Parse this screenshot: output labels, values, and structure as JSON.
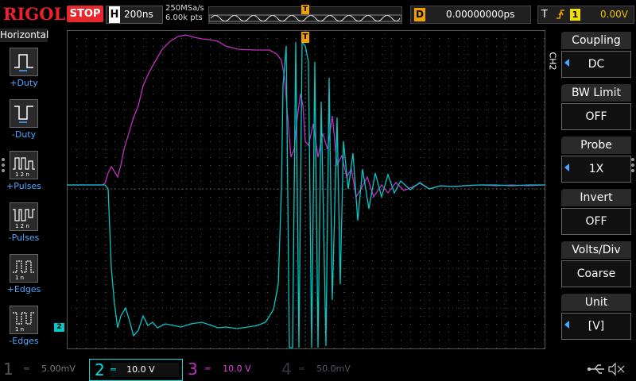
{
  "header": {
    "logo": "RIGOL",
    "run_state": "STOP",
    "horizontal_letter": "H",
    "timebase": "200ns",
    "sample_rate": "250MSa/s",
    "points": "6.00k pts",
    "trigger_marker": "T",
    "delay_letter": "D",
    "delay_value": "0.00000000ps",
    "trigger_letter": "T",
    "trigger_edge_icon": "rising-edge-icon",
    "trigger_source": "1",
    "trigger_level": "0.00V"
  },
  "left_menu": {
    "title": "Horizontal",
    "items": [
      {
        "label": "+Duty",
        "icon": "positive-duty-icon"
      },
      {
        "label": "-Duty",
        "icon": "negative-duty-icon"
      },
      {
        "label": "+Pulses",
        "icon": "positive-pulses-icon"
      },
      {
        "label": "-Pulses",
        "icon": "negative-pulses-icon"
      },
      {
        "label": "+Edges",
        "icon": "positive-edges-icon"
      },
      {
        "label": "-Edges",
        "icon": "negative-edges-icon"
      }
    ]
  },
  "screen": {
    "ch2_ground_marker": "2",
    "trigger_position_marker": "T"
  },
  "right_menu": {
    "channel_tag": "CH2",
    "items": [
      {
        "title": "Coupling",
        "value": "DC"
      },
      {
        "title": "BW Limit",
        "value": "OFF"
      },
      {
        "title": "Probe",
        "value": "1X"
      },
      {
        "title": "Invert",
        "value": "OFF"
      },
      {
        "title": "Volts/Div",
        "value": "Coarse"
      },
      {
        "title": "Unit",
        "value": "[V]"
      }
    ]
  },
  "channels": [
    {
      "num": "1",
      "scale": "5.00mV",
      "color": "#f0e000",
      "active": false
    },
    {
      "num": "2",
      "scale": "10.0 V",
      "color": "#00e0e0",
      "active": true
    },
    {
      "num": "3",
      "scale": "10.0 V",
      "color": "#e040e0",
      "active": false
    },
    {
      "num": "4",
      "scale": "50.0mV",
      "color": "#4060ff",
      "active": false
    }
  ],
  "status_icons": [
    "usb-icon",
    "speaker-muted-icon"
  ],
  "colors": {
    "accent": "#4da6ff",
    "ch2": "#00c8c8",
    "ch3": "#c030c0",
    "stop": "#e8282a",
    "trigger": "#f0a000"
  }
}
